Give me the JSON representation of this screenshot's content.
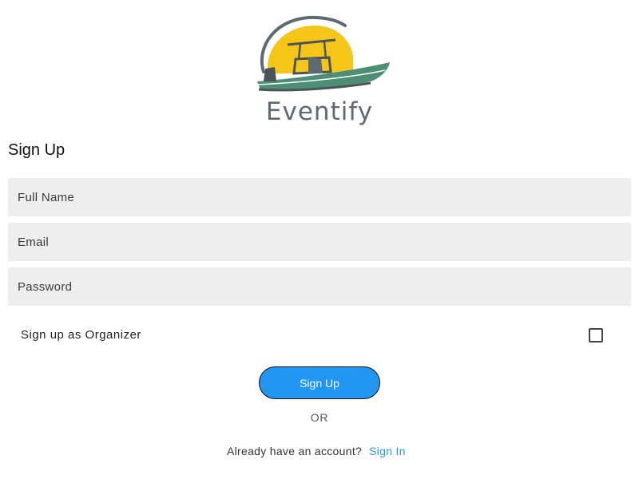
{
  "logo": {
    "text": "Eventify",
    "icon": "boat-sunset-logo",
    "colors": {
      "sun": "#f5c518",
      "hull": "#4c8f74",
      "ring": "#5d6a70"
    }
  },
  "form": {
    "title": "Sign Up",
    "full_name_placeholder": "Full Name",
    "email_placeholder": "Email",
    "password_placeholder": "Password",
    "organizer_label": "Sign up as Organizer",
    "organizer_checked": false,
    "submit_label": "Sign Up",
    "divider_text": "OR",
    "account_prompt": "Already have an account?",
    "signin_label": "Sign In"
  },
  "colors": {
    "accent": "#2196f3",
    "field_bg": "#eeeeee"
  }
}
